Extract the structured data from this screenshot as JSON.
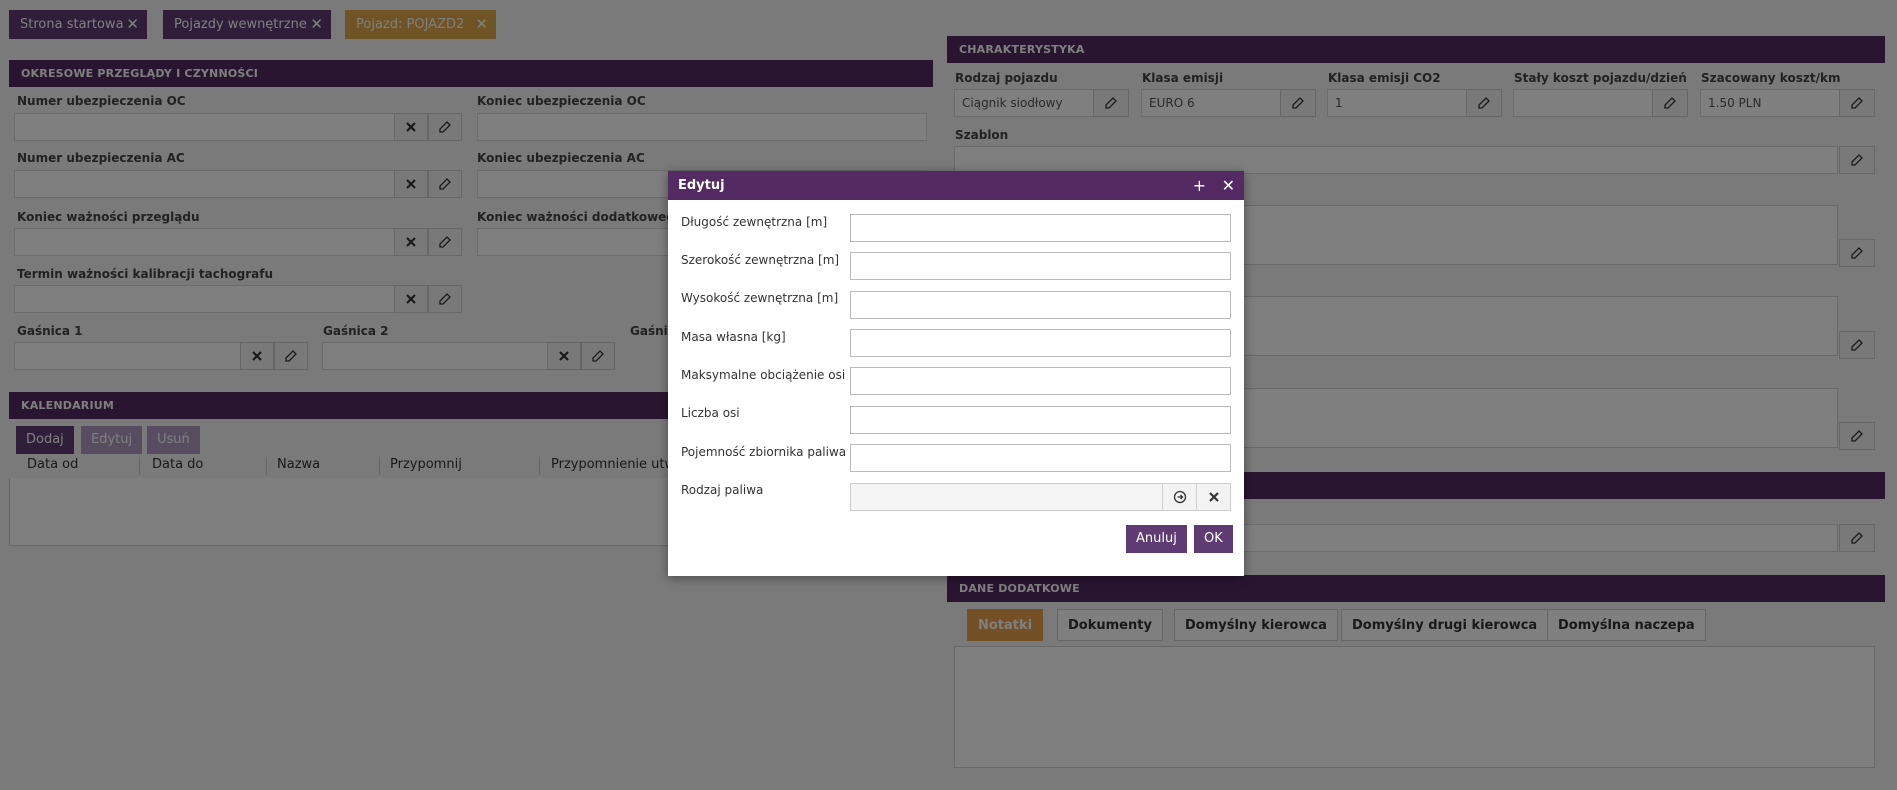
{
  "tabs": [
    {
      "label": "Strona startowa",
      "close": "✕"
    },
    {
      "label": "Pojazdy wewnętrzne",
      "close": "✕"
    },
    {
      "label": "Pojazd: POJAZD2",
      "close": "✕"
    }
  ],
  "periodic": {
    "title": "OKRESOWE PRZEGLĄDY I CZYNNOŚCI",
    "oc_number_label": "Numer ubezpieczenia OC",
    "oc_end_label": "Koniec ubezpieczenia OC",
    "ac_number_label": "Numer ubezpieczenia AC",
    "ac_end_label": "Koniec ubezpieczenia AC",
    "inspection_end_label": "Koniec ważności przeglądu",
    "extra_inspection_end_label": "Koniec ważności dodatkowego p",
    "tacho_label": "Termin ważności kalibracji tachografu",
    "ext1_label": "Gaśnica 1",
    "ext2_label": "Gaśnica 2",
    "ext3_label": "Gaśnic"
  },
  "calendar": {
    "title": "KALENDARIUM",
    "add": "Dodaj",
    "edit": "Edytuj",
    "delete": "Usuń",
    "columns": [
      "Data od",
      "Data do",
      "Nazwa",
      "Przypomnij",
      "Przypomnienie utwo"
    ]
  },
  "characteristics": {
    "title": "CHARAKTERYSTYKA",
    "vehicle_type_label": "Rodzaj pojazdu",
    "vehicle_type_value": "Ciągnik siodłowy",
    "emission_label": "Klasa emisji",
    "emission_value": "EURO 6",
    "co2_label": "Klasa emisji CO2",
    "co2_value": "1",
    "fixed_cost_label": "Stały koszt pojazdu/dzień",
    "fixed_cost_value": "",
    "cost_km_label": "Szacowany koszt/km",
    "cost_km_value": "1.50 PLN",
    "template_label": "Szablon"
  },
  "additional": {
    "title": "DANE DODATKOWE",
    "tabs": [
      "Notatki",
      "Dokumenty",
      "Domyślny kierowca",
      "Domyślny drugi kierowca",
      "Domyślna naczepa"
    ]
  },
  "dialog": {
    "title": "Edytuj",
    "plus": "+",
    "close": "✕",
    "fields": [
      {
        "label": "Długość zewnętrzna [m]",
        "value": ""
      },
      {
        "label": "Szerokość zewnętrzna [m]",
        "value": ""
      },
      {
        "label": "Wysokość zewnętrzna [m]",
        "value": ""
      },
      {
        "label": "Masa własna [kg]",
        "value": ""
      },
      {
        "label": "Maksymalne obciążenie osi [t]",
        "value": ""
      },
      {
        "label": "Liczba osi",
        "value": ""
      },
      {
        "label": "Pojemność zbiornika paliwa [l]",
        "value": ""
      },
      {
        "label": "Rodzaj paliwa",
        "value": ""
      }
    ],
    "cancel": "Anuluj",
    "ok": "OK"
  },
  "icons": {
    "clear": "x-icon",
    "edit": "edit-icon",
    "select": "arrow-circle-icon"
  },
  "colors": {
    "header": "#542a63",
    "primary": "#5e3b73",
    "active_tab": "#e8a04f"
  }
}
